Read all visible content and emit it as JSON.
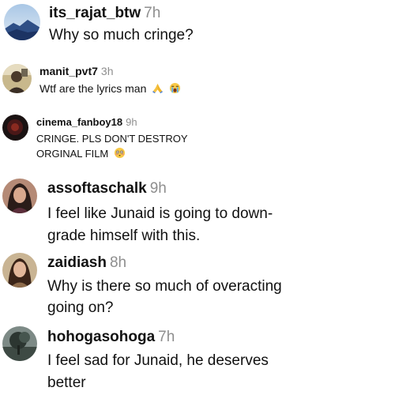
{
  "comments": [
    {
      "username": "its_rajat_btw",
      "time": "7h",
      "text": "Why so much cringe?",
      "avatar_icon": "mountain-sky-avatar"
    },
    {
      "username": "manit_pvt7",
      "time": "3h",
      "text": "Wtf are the lyrics man",
      "emojis": [
        "folded-hands-emoji",
        "loudly-crying-emoji"
      ],
      "avatar_icon": "person-photo-avatar"
    },
    {
      "username": "cinema_fanboy18",
      "time": "9h",
      "text_line1": "CRINGE. PLS DON'T DESTROY",
      "text_line2": "ORGINAL FILM",
      "emojis": [
        "flushed-face-emoji"
      ],
      "avatar_icon": "dark-red-avatar"
    },
    {
      "username": "assoftaschalk",
      "time": "9h",
      "text_line1": "I feel like Junaid is going to down-",
      "text_line2": "grade himself with this.",
      "avatar_icon": "woman-portrait-avatar"
    },
    {
      "username": "zaidiash",
      "time": "8h",
      "text_line1": "Why is there so much of overacting",
      "text_line2": "going on?",
      "avatar_icon": "woman-portrait-avatar"
    },
    {
      "username": "hohogasohoga",
      "time": "7h",
      "text_line1": "I feel sad for Junaid, he deserves",
      "text_line2": "better",
      "avatar_icon": "tree-landscape-avatar"
    }
  ],
  "colors": {
    "username": "#111111",
    "timestamp": "#8e8e8e",
    "text": "#111111",
    "background": "#ffffff"
  }
}
